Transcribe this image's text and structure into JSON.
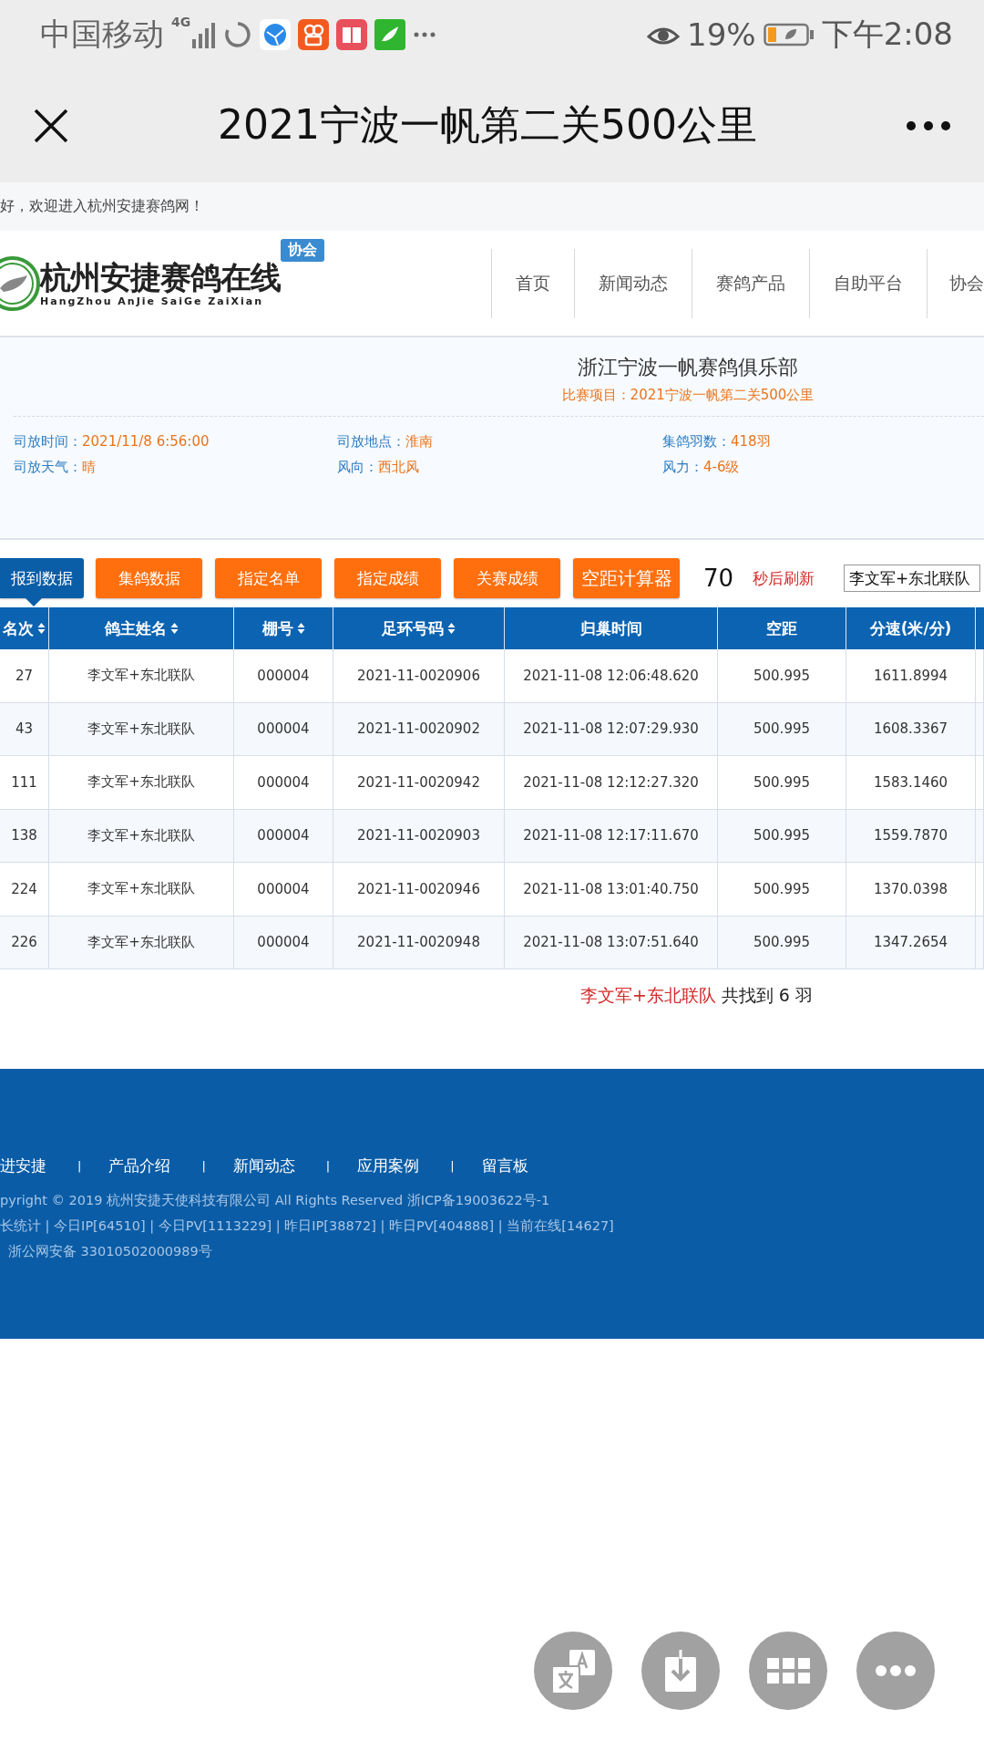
{
  "status_bar": {
    "carrier": "中国移动",
    "network": "4G",
    "battery": "19%",
    "time": "下午2:08"
  },
  "title_bar": {
    "title": "2021宁波一帆第二关500公里"
  },
  "welcome": "好，欢迎进入杭州安捷赛鸽网！",
  "header": {
    "logo_title": "杭州安捷赛鸽在线",
    "logo_subtitle": "HangZhou AnJie SaiGe ZaiXian",
    "badge": "协会",
    "nav": [
      {
        "label": "首页"
      },
      {
        "label": "新闻动态"
      },
      {
        "label": "赛鸽产品"
      },
      {
        "label": "自助平台"
      },
      {
        "label": "协会"
      }
    ]
  },
  "race_info": {
    "club": "浙江宁波一帆赛鸽俱乐部",
    "event": "比赛项目：2021宁波一帆第二关500公里",
    "fields": [
      {
        "label": "司放时间：",
        "value": "2021/11/8 6:56:00"
      },
      {
        "label": "司放地点：",
        "value": "淮南"
      },
      {
        "label": "集鸽羽数：",
        "value": "418羽"
      },
      {
        "label": "司放天气：",
        "value": "晴"
      },
      {
        "label": "风向：",
        "value": "西北风"
      },
      {
        "label": "风力：",
        "value": "4-6级"
      }
    ]
  },
  "toolbar": {
    "buttons": [
      {
        "label": "报到数据",
        "kind": "tab",
        "selected": true
      },
      {
        "label": "集鸽数据",
        "kind": "tab",
        "selected": false
      },
      {
        "label": "指定名单",
        "kind": "tab",
        "selected": false
      },
      {
        "label": "指定成绩",
        "kind": "tab",
        "selected": false
      },
      {
        "label": "关赛成绩",
        "kind": "tab",
        "selected": false
      },
      {
        "label": "空距计算器",
        "kind": "tool",
        "selected": false
      }
    ],
    "countdown": "70",
    "countdown_label": "秒后刷新",
    "search_value": "李文军+东北联队"
  },
  "table": {
    "columns": [
      {
        "label": "名次",
        "sortable": true
      },
      {
        "label": "鸽主姓名",
        "sortable": true
      },
      {
        "label": "棚号",
        "sortable": true
      },
      {
        "label": "足环号码",
        "sortable": true
      },
      {
        "label": "归巢时间",
        "sortable": false
      },
      {
        "label": "空距",
        "sortable": false
      },
      {
        "label": "分速(米/分)",
        "sortable": false
      }
    ],
    "rows": [
      [
        "27",
        "李文军+东北联队",
        "000004",
        "2021-11-0020906",
        "2021-11-08 12:06:48.620",
        "500.995",
        "1611.8994"
      ],
      [
        "43",
        "李文军+东北联队",
        "000004",
        "2021-11-0020902",
        "2021-11-08 12:07:29.930",
        "500.995",
        "1608.3367"
      ],
      [
        "111",
        "李文军+东北联队",
        "000004",
        "2021-11-0020942",
        "2021-11-08 12:12:27.320",
        "500.995",
        "1583.1460"
      ],
      [
        "138",
        "李文军+东北联队",
        "000004",
        "2021-11-0020903",
        "2021-11-08 12:17:11.670",
        "500.995",
        "1559.7870"
      ],
      [
        "224",
        "李文军+东北联队",
        "000004",
        "2021-11-0020946",
        "2021-11-08 13:01:40.750",
        "500.995",
        "1370.0398"
      ],
      [
        "226",
        "李文军+东北联队",
        "000004",
        "2021-11-0020948",
        "2021-11-08 13:07:51.640",
        "500.995",
        "1347.2654"
      ]
    ]
  },
  "summary": {
    "query": "李文军+东北联队",
    "text": "共找到 6 羽"
  },
  "footer": {
    "links": [
      "进安捷",
      "产品介绍",
      "新闻动态",
      "应用案例",
      "留言板"
    ],
    "separator": "|",
    "lines": [
      "pyright © 2019 杭州安捷天使科技有限公司 All Rights Reserved 浙ICP备19003622号-1",
      "长统计 | 今日IP[64510] | 今日PV[1113229] | 昨日IP[38872] | 昨日PV[404888] | 当前在线[14627]",
      "浙公网安备 33010502000989号"
    ]
  }
}
